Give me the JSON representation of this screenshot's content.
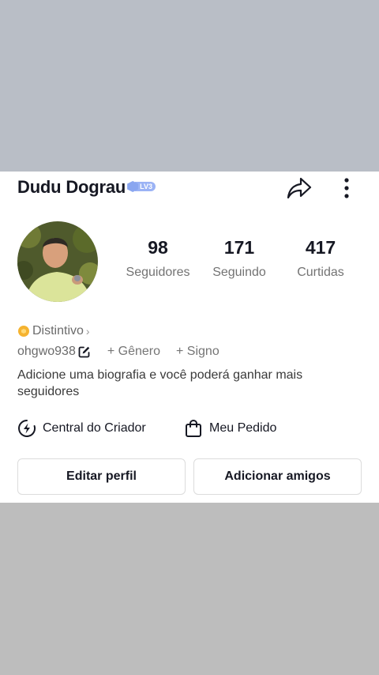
{
  "profile": {
    "display_name": "Dudu Dograu",
    "level_badge": "LV3",
    "handle": "ohgwo938",
    "badge_label": "Distintivo",
    "badge_chevron": "›",
    "add_gender": "+ Gênero",
    "add_sign": "+ Signo",
    "bio_prompt": "Adicione uma biografia e você poderá ganhar mais seguidores"
  },
  "stats": [
    {
      "value": "98",
      "label": "Seguidores"
    },
    {
      "value": "171",
      "label": "Seguindo"
    },
    {
      "value": "417",
      "label": "Curtidas"
    }
  ],
  "actions": {
    "creator_center": "Central do Criador",
    "my_order": "Meu Pedido"
  },
  "buttons": {
    "edit_profile": "Editar perfil",
    "add_friends": "Adicionar amigos"
  },
  "icons": {
    "share": "share-arrow-icon",
    "more": "vertical-dots-icon",
    "edit": "edit-pencil-icon",
    "creator": "lightning-circle-icon",
    "order": "shopping-bag-icon",
    "badge": "coin-badge-icon"
  },
  "colors": {
    "top_band": "#b9bec6",
    "bottom_band": "#bdbdbd",
    "level_badge": "#9bb3f5",
    "badge_coin": "#f5b330"
  }
}
